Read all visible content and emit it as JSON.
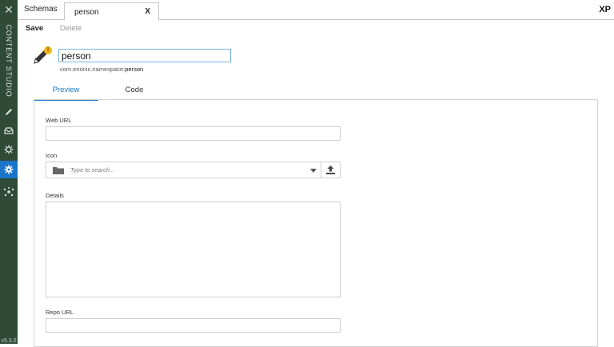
{
  "sidebar": {
    "app_name": "CONTENT STUDIO",
    "version": "v5.3.0",
    "icons": [
      "close-icon",
      "pencil-icon",
      "inbox-icon",
      "gear-outline-icon",
      "gear-icon",
      "network-icon"
    ],
    "active_color": "#1a74c9",
    "background": "#2f4a37"
  },
  "header": {
    "tab_schemas": "Schemas",
    "tab_person": "person",
    "tab_close": "X",
    "logo": "XP"
  },
  "toolbar": {
    "save_label": "Save",
    "delete_label": "Delete"
  },
  "schema": {
    "name": "person",
    "namespace_prefix": "com.enonic.namespace:",
    "namespace_name": "person",
    "warning_badge": "!"
  },
  "tabs": {
    "preview": "Preview",
    "code": "Code"
  },
  "form": {
    "web_url_label": "Web URL",
    "web_url_value": "",
    "icon_label": "Icon",
    "icon_placeholder": "Type to search...",
    "details_label": "Details",
    "details_value": "",
    "repo_url_label": "Repo URL",
    "repo_url_value": ""
  }
}
